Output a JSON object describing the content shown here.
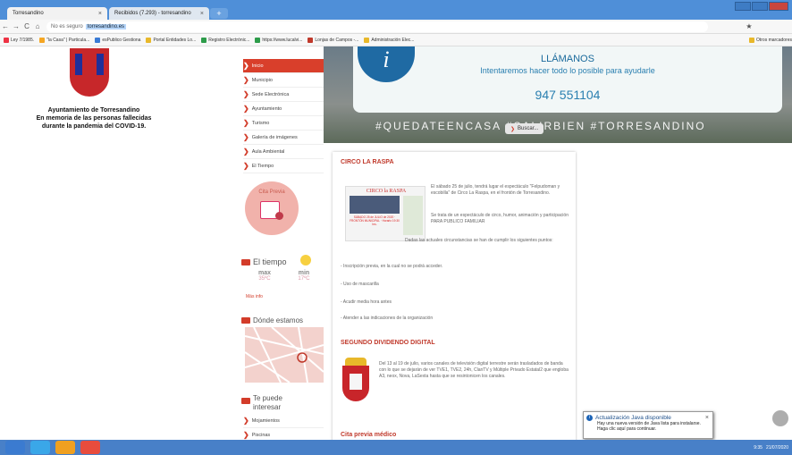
{
  "browser": {
    "tabs": [
      {
        "title": "Torresandino",
        "close": "×"
      },
      {
        "title": "Recibidos (7.293) - torresandino",
        "close": "×"
      }
    ],
    "newtab": "+",
    "nav": {
      "back": "←",
      "forward": "→",
      "reload": "C",
      "home": "⌂"
    },
    "url": {
      "security": "No es seguro",
      "host": "torresandino.es"
    },
    "star": "★",
    "bookmarks": [
      "Ley 7/1985.",
      "\"la Casa\" | Particula...",
      "esPublico Gestiona",
      "Portal Entidades Lo...",
      "Registro Electrónic...",
      "https://www.lucalvi...",
      "Lonjas de Campos -...",
      "Administración Elec...",
      "Otros marcadores"
    ],
    "bookmark_colors": [
      "#e34",
      "#f5a623",
      "#3a7bd5",
      "#e8b82a",
      "#2d9c4a",
      "#2d9c4a",
      "#c0392b",
      "#e8b82a",
      "#e8b82a"
    ]
  },
  "hero": {
    "info_icon": "i",
    "call_title": "LLÁMANOS",
    "call_text": "Intentaremos hacer todo lo posible para ayudarle",
    "phone": "947 551104",
    "hashtags": "#QUEDATEENCASA  #SALIRBIEN #TORRESANDINO",
    "search_label": "Buscar..."
  },
  "header": {
    "town_line1": "Ayuntamiento de Torresandino",
    "town_line2": "En memoria de las personas fallecidas",
    "town_line3": "durante la pandemia del COVID-19."
  },
  "menu": [
    "Inicio",
    "Municipio",
    "Sede Electrónica",
    "Ayuntamiento",
    "Turismo",
    "Galería de imágenes",
    "Aula Ambiental",
    "El Tiempo"
  ],
  "cita": {
    "label": "Cita Previa"
  },
  "weather": {
    "title": "El tiempo",
    "max_label": "max",
    "min_label": "min",
    "max_value": "35ºC",
    "min_value": "17ºC",
    "more": "Más info"
  },
  "donde": {
    "title": "Dónde estamos"
  },
  "interes": {
    "title_line1": "Te puede",
    "title_line2": "interesar",
    "items": [
      "Mojamientos",
      "Piscinas"
    ]
  },
  "articles": {
    "circo_title": "CIRCO LA RASPA",
    "poster_title": "CIRCO la RASPA",
    "poster_text": "SÁBADO 25 de JULIO de 2020 · FRONTÓN MUNICIPAL · Horario 19:30 hrs.",
    "circo_p1": "El sábado 25 de julio, tendrá lugar el espectáculo \"Felpudoman y escobilla\" de Circo La Raspa, en el frontón de Torresandino.",
    "circo_p2": "Se trata de un espectáculo de circo, humor, animación y participación PARA PUBLICO FAMILIAR",
    "circo_p3": "Dadas las actuales circunstancias se han de cumplir los siguientes puntos:",
    "circo_p4": "- Inscripción previa, en la cual no se podrá acceder.",
    "circo_p5": "- Uso de mascarilla",
    "circo_p6": "- Acudir media hora antes",
    "circo_p7": "- Atender a las indicaciones de la organización",
    "digital_title": "SEGUNDO DIVIDENDO DIGITAL",
    "digital_p": "Del 13 al 19 de julio, varios canales de televisión digital terrestre serán trasladados de banda con lo que se dejarán de ver TVE1, TVE2, 24h, ClanTV y Múltiple Privado Estatal2 que engloba A3, neox, Nova, LaSexta hasta que se resintonicen los canales.",
    "cita_title": "Cita previa médico"
  },
  "java": {
    "title": "Actualización Java disponible",
    "body": "Hay una nueva versión de Java lista para instalarse. Haga clic aquí para continuar.",
    "close": "×",
    "icon": "i"
  },
  "taskbar": {
    "clock": "9:35",
    "date": "21/07/2020",
    "app_colors": [
      "#3b7bd0",
      "#3aa7e8",
      "#f0a020",
      "#e84c3d"
    ]
  }
}
